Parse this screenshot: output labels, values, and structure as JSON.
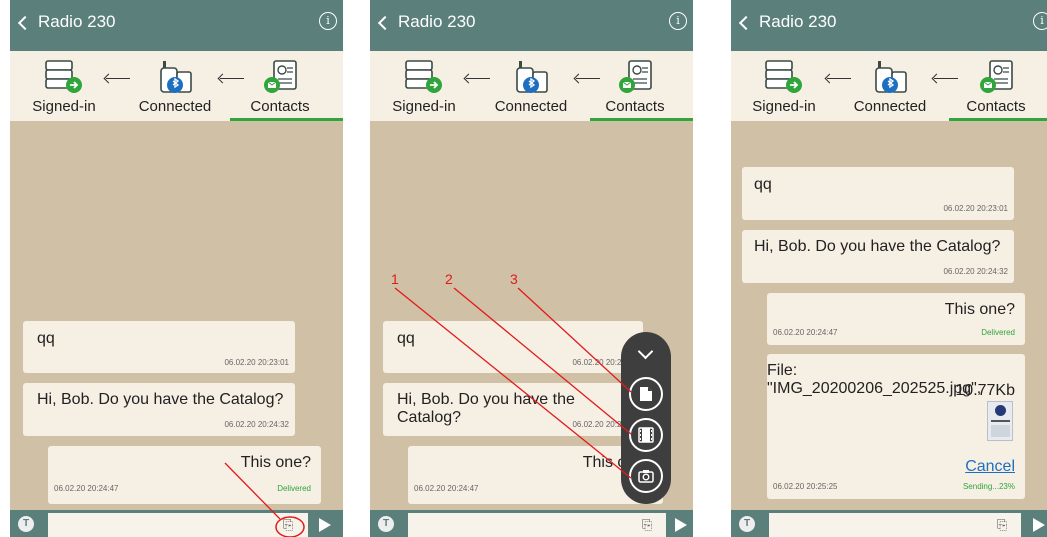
{
  "app": {
    "title": "Radio 230",
    "info_icon": "info-icon",
    "back_icon": "back-chevron-icon"
  },
  "status": {
    "signed_in": "Signed-in",
    "connected": "Connected",
    "contacts": "Contacts"
  },
  "messages": [
    {
      "text": "qq",
      "time": "06.02.20 20:23:01"
    },
    {
      "text": "Hi, Bob. Do you have the Catalog?",
      "time": "06.02.20 20:24:32"
    },
    {
      "text": "This one?",
      "time": "06.02.20 20:24:47",
      "status": "Delivered"
    }
  ],
  "file_message": {
    "line1": "File: \"IMG_20200206_202525.jpg\",",
    "line2": "10.77Kb",
    "cancel": "Cancel",
    "time": "06.02.20 20:25:25",
    "status": "Sending...23%"
  },
  "annotations": [
    "1",
    "2",
    "3"
  ],
  "colors": {
    "header": "#5b7f7b",
    "background": "#cfc0a6",
    "bubble": "#f6efe4",
    "accent": "#2fa53b",
    "annotation": "#e21a1a"
  }
}
